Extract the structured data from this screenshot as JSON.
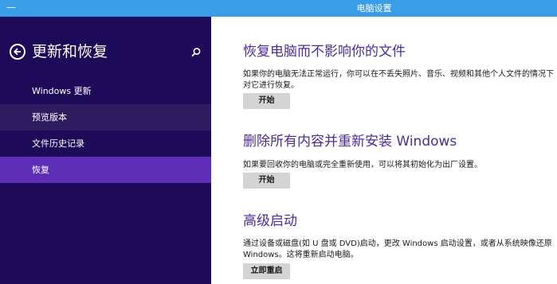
{
  "window": {
    "title": "电脑设置",
    "minimize_label": "—"
  },
  "sidebar": {
    "title": "更新和恢复",
    "items": [
      {
        "label": "Windows 更新"
      },
      {
        "label": "预览版本"
      },
      {
        "label": "文件历史记录"
      },
      {
        "label": "恢复"
      }
    ]
  },
  "main": {
    "sections": [
      {
        "title": "恢复电脑而不影响你的文件",
        "description": "如果你的电脑无法正常运行，你可以在不丢失照片、音乐、视频和其他个人文件的情况下对它进行恢复。",
        "button_label": "开始"
      },
      {
        "title": "删除所有内容并重新安装 Windows",
        "description": "如果要回收你的电脑或完全重新使用，可以将其初始化为出厂设置。",
        "button_label": "开始"
      },
      {
        "title": "高级启动",
        "description": "通过设备或磁盘(如 U 盘或 DVD)启动，更改 Windows 启动设置，或者从系统映像还原 Windows。这将重新启动电脑。",
        "button_label": "立即重启"
      }
    ]
  },
  "colors": {
    "titlebar": "#3a9de8",
    "sidebar_bg": "#1d0a58",
    "sidebar_active": "#5d2eb5",
    "section_title": "#4b2c9c",
    "button_bg": "#d4d4d4"
  },
  "icons": {
    "back": "back-arrow-circle-icon",
    "search": "search-icon"
  }
}
